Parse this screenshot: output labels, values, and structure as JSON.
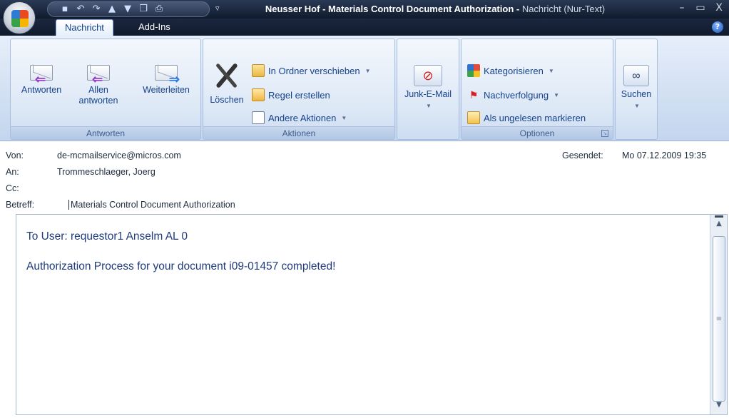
{
  "window": {
    "title_main": "Neusser Hof - Materials Control Document Authorization - ",
    "title_sub": "Nachricht (Nur-Text)",
    "controls": [
      "–",
      "▭",
      "X"
    ]
  },
  "tabs": [
    {
      "label": "Nachricht",
      "active": true
    },
    {
      "label": "Add-Ins",
      "active": false
    }
  ],
  "ribbon": {
    "antworten": {
      "label": "Antworten",
      "buttons": [
        "Antworten",
        "Allen antworten",
        "Weiterleiten"
      ]
    },
    "aktionen": {
      "label": "Aktionen",
      "delete": "Löschen",
      "move": "In Ordner verschieben",
      "rule": "Regel erstellen",
      "other": "Andere Aktionen"
    },
    "junk": {
      "label": "Junk-E-Mail"
    },
    "optionen": {
      "label": "Optionen",
      "categorize": "Kategorisieren",
      "followup": "Nachverfolgung",
      "mark_unread": "Als ungelesen markieren"
    },
    "suchen": {
      "label": "Suchen"
    }
  },
  "header": {
    "from_label": "Von:",
    "from": "de-mcmailservice@micros.com",
    "to_label": "An:",
    "to": "Trommeschlaeger, Joerg",
    "cc_label": "Cc:",
    "cc": "",
    "subject_label": "Betreff:",
    "subject": "Materials Control Document Authorization",
    "sent_label": "Gesendet:",
    "sent": "Mo 07.12.2009 19:35"
  },
  "body": {
    "line1": "To User: requestor1 Anselm AL 0",
    "line2": "Authorization Process for your document i09-01457 completed!"
  }
}
